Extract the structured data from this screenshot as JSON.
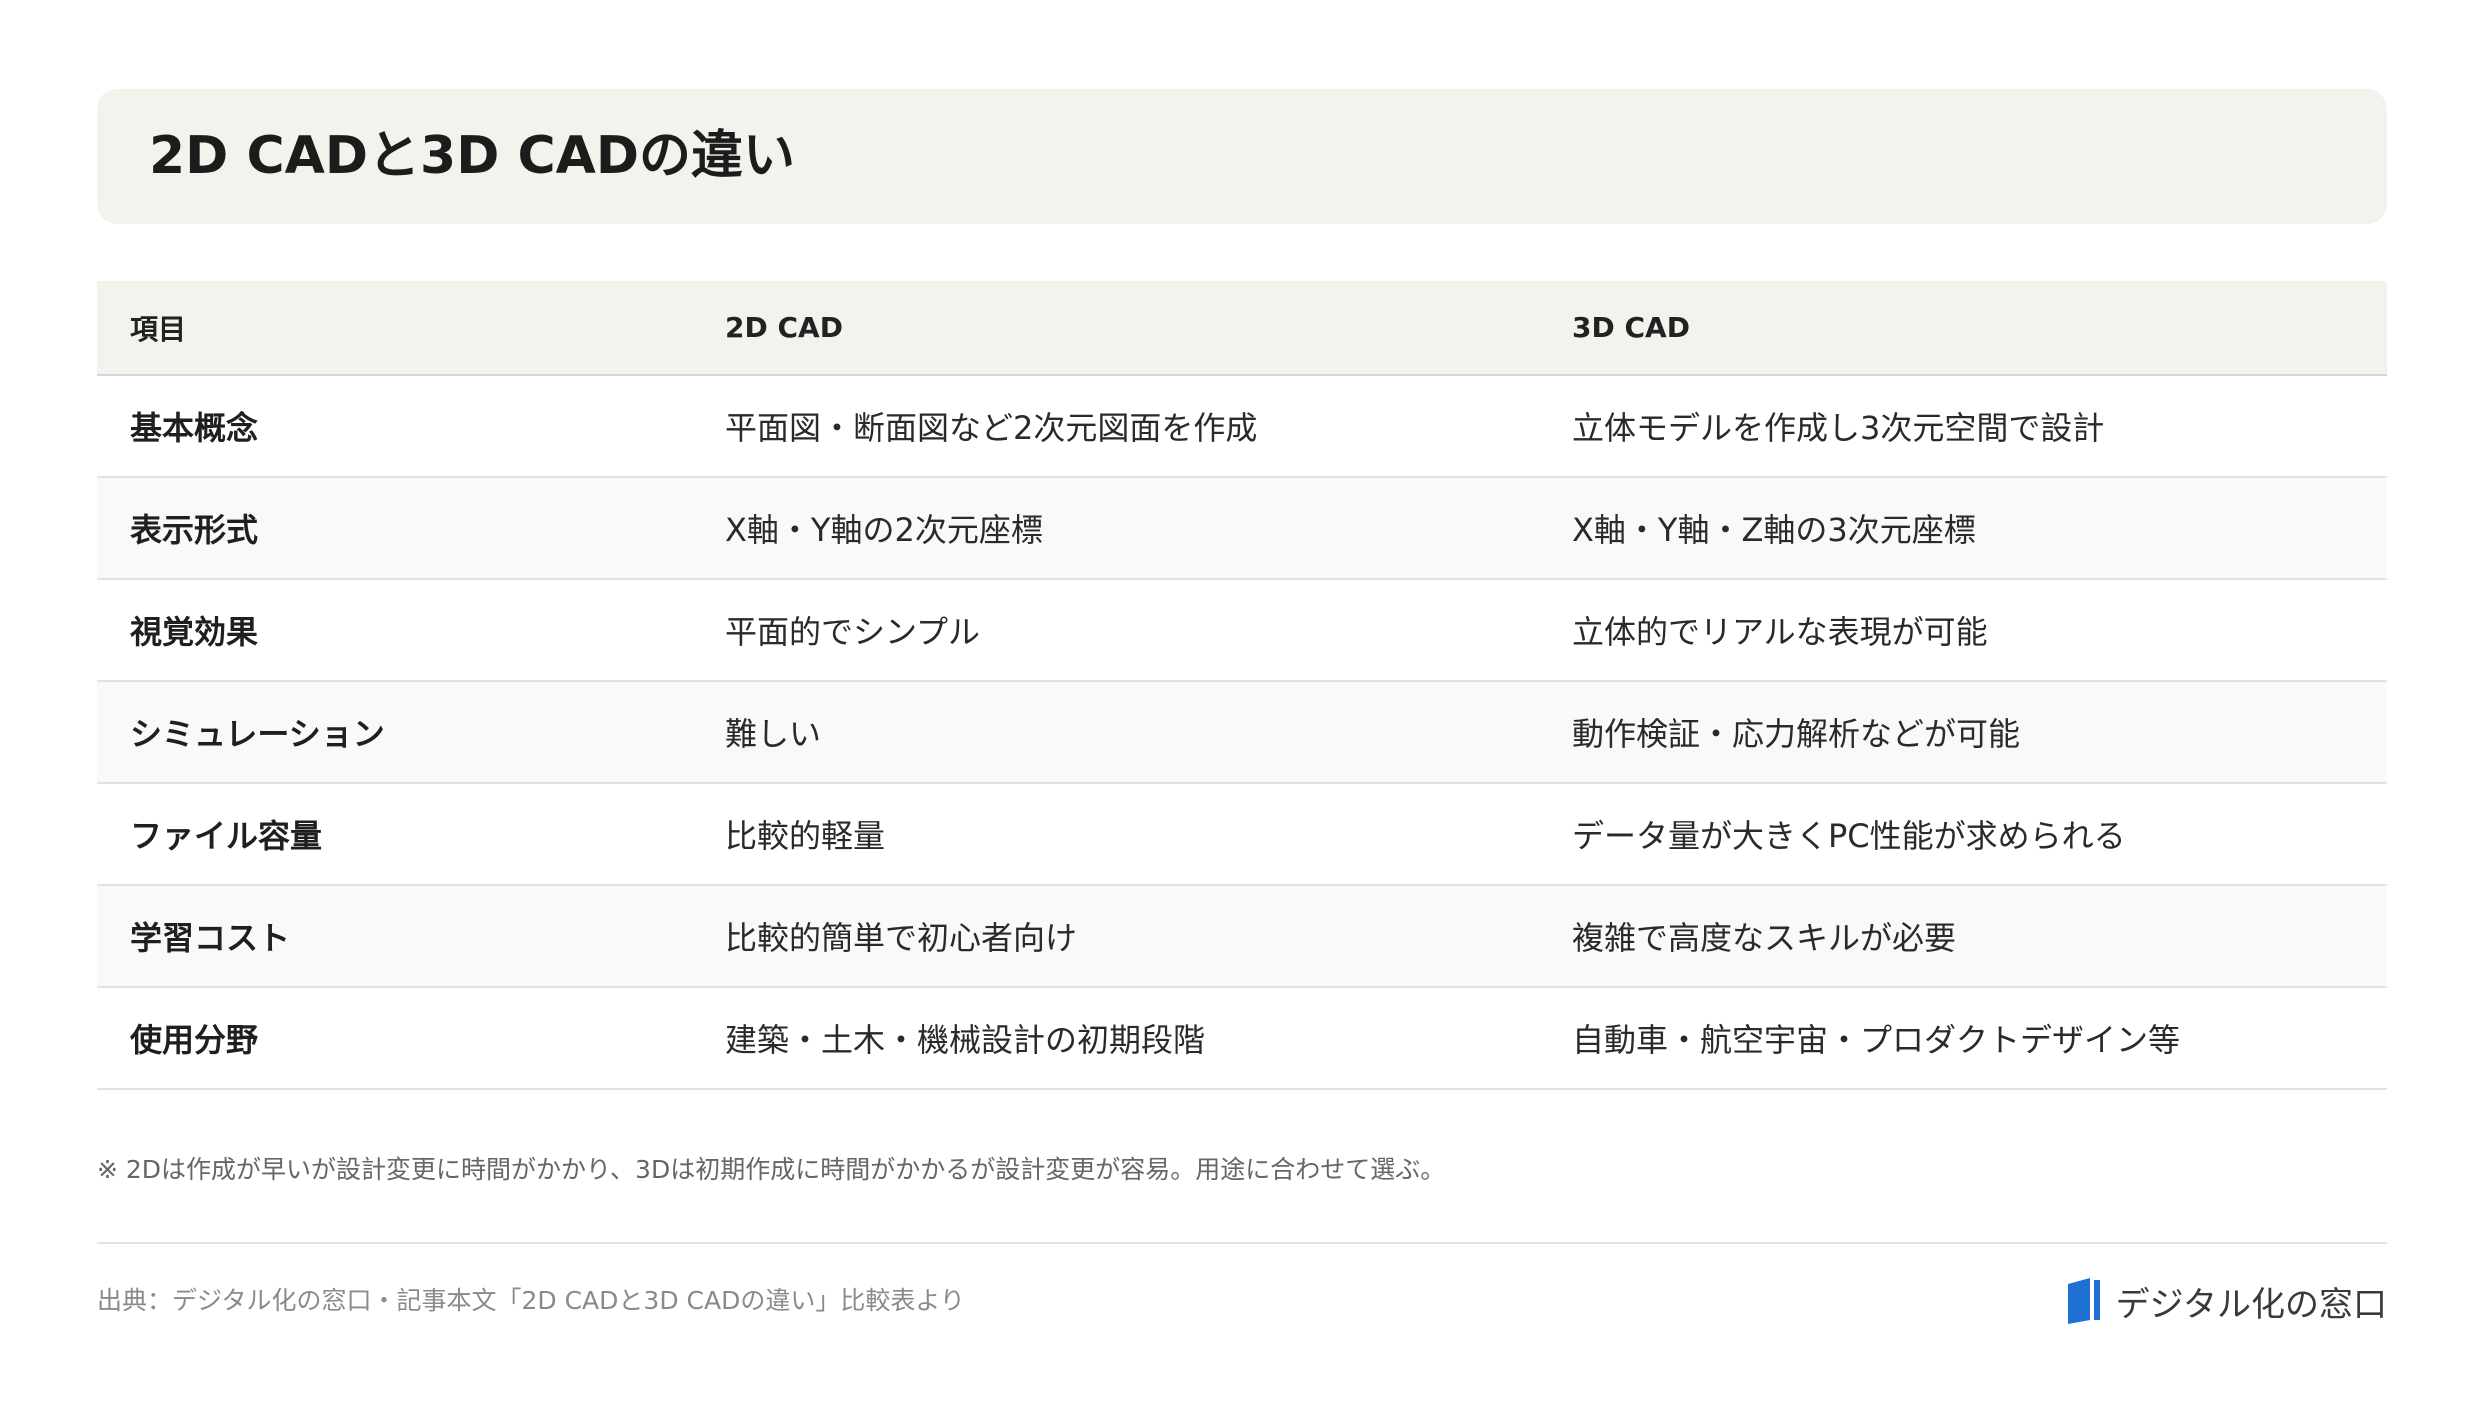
{
  "title": "2D CADと3D CADの違い",
  "table": {
    "headers": [
      "項目",
      "2D CAD",
      "3D CAD"
    ],
    "rows": [
      {
        "item": "基本概念",
        "cad2d": "平面図・断面図など2次元図面を作成",
        "cad3d": "立体モデルを作成し3次元空間で設計"
      },
      {
        "item": "表示形式",
        "cad2d": "X軸・Y軸の2次元座標",
        "cad3d": "X軸・Y軸・Z軸の3次元座標"
      },
      {
        "item": "視覚効果",
        "cad2d": "平面的でシンプル",
        "cad3d": "立体的でリアルな表現が可能"
      },
      {
        "item": "シミュレーション",
        "cad2d": "難しい",
        "cad3d": "動作検証・応力解析などが可能"
      },
      {
        "item": "ファイル容量",
        "cad2d": "比較的軽量",
        "cad3d": "データ量が大きくPC性能が求められる"
      },
      {
        "item": "学習コスト",
        "cad2d": "比較的簡単で初心者向け",
        "cad3d": "複雑で高度なスキルが必要"
      },
      {
        "item": "使用分野",
        "cad2d": "建築・土木・機械設計の初期段階",
        "cad3d": "自動車・航空宇宙・プロダクトデザイン等"
      }
    ]
  },
  "note": "※ 2Dは作成が早いが設計変更に時間がかかり、3Dは初期作成に時間がかかるが設計変更が容易。用途に合わせて選ぶ。",
  "source": "出典：デジタル化の窓口・記事本文「2D CADと3D CADの違い」比較表より",
  "brand": {
    "name": "デジタル化の窓口",
    "icon": "window-logo-icon",
    "color": "#1d6fd1"
  }
}
